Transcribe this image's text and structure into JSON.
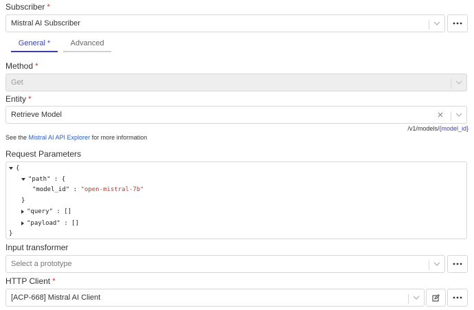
{
  "subscriber": {
    "label": "Subscriber",
    "required": "*",
    "value": "Mistral AI Subscriber"
  },
  "tabs": [
    {
      "label": "General",
      "required": "*"
    },
    {
      "label": "Advanced"
    }
  ],
  "method": {
    "label": "Method",
    "required": "*",
    "value": "Get"
  },
  "entity": {
    "label": "Entity",
    "required": "*",
    "value": "Retrieve Model"
  },
  "endpoint": {
    "prefix": "/v1/models/",
    "variable": "{model_id}"
  },
  "info": {
    "pre": "See the ",
    "link": "Mistral AI API Explorer",
    "post": " for more information"
  },
  "request_parameters": {
    "label": "Request Parameters",
    "lines": {
      "open": "{",
      "path_key": "\"path\"",
      "path_open": " : {",
      "model_id_key": "\"model_id\"",
      "model_id_sep": " : ",
      "model_id_value": "\"open-mistral-7b\"",
      "path_close": "}",
      "query_key": "\"query\"",
      "query_value": " : []",
      "payload_key": "\"payload\"",
      "payload_value": " : []",
      "close": "}"
    }
  },
  "input_transformer": {
    "label": "Input transformer",
    "placeholder": "Select a prototype"
  },
  "http_client": {
    "label": "HTTP Client",
    "required": "*",
    "value": "[ACP-668] Mistral AI Client"
  },
  "icons": {
    "more": "more-horizontal-icon",
    "chevron": "chevron-down-icon",
    "clear": "close-icon",
    "edit": "edit-icon"
  },
  "colors": {
    "accent": "#3a3fb0",
    "required": "#e03c31",
    "link": "#2b5db7",
    "json_string": "#c0392b"
  }
}
